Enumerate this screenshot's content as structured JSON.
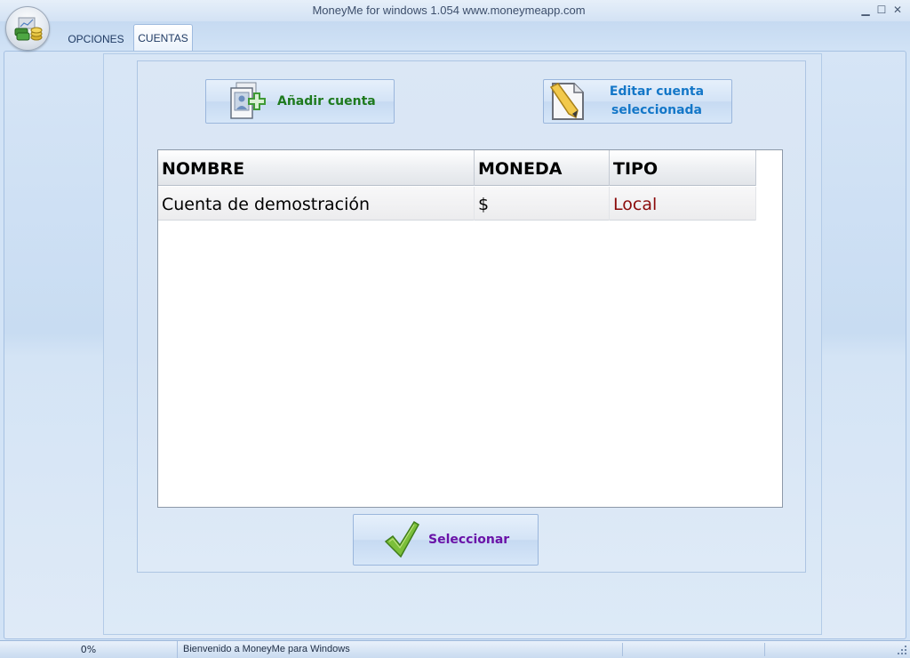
{
  "window": {
    "title": "MoneyMe for windows 1.054 www.moneymeapp.com",
    "minimize_glyph": "▁",
    "maximize_glyph": "☐",
    "close_glyph": "✕"
  },
  "app_orb": {
    "icon": "money-stack-icon"
  },
  "tabs": [
    {
      "label": "OPCIONES",
      "active": false
    },
    {
      "label": "CUENTAS",
      "active": true
    }
  ],
  "actions": {
    "add_account": {
      "label": "Añadir cuenta",
      "icon": "add-account-icon",
      "color": "#1e7a1e"
    },
    "edit_account": {
      "label": "Editar cuenta seleccionada",
      "icon": "edit-document-icon",
      "color": "#1477c8"
    },
    "select": {
      "label": "Seleccionar",
      "icon": "checkmark-icon",
      "color": "#6a13a8"
    }
  },
  "accounts_table": {
    "columns": [
      "NOMBRE",
      "MONEDA",
      "TIPO"
    ],
    "rows": [
      {
        "nombre": "Cuenta de demostración",
        "moneda": "$",
        "tipo": "Local"
      }
    ]
  },
  "statusbar": {
    "progress_text": "0%",
    "progress": 0,
    "message": "Bienvenido a MoneyMe para Windows"
  }
}
